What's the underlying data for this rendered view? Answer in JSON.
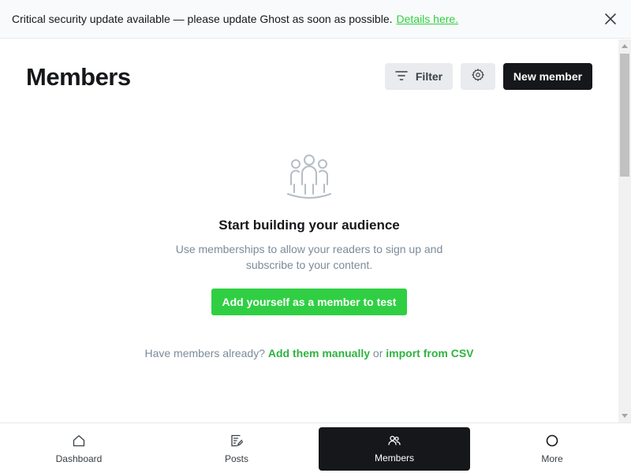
{
  "banner": {
    "message": "Critical security update available — please update Ghost as soon as possible.",
    "link_label": "Details here."
  },
  "header": {
    "title": "Members",
    "filter_label": "Filter",
    "new_member_label": "New member"
  },
  "empty_state": {
    "title": "Start building your audience",
    "description": "Use memberships to allow your readers to sign up and subscribe to your content.",
    "cta_label": "Add yourself as a member to test",
    "already_prefix": "Have members already?",
    "add_manually_label": "Add them manually",
    "or_label": "or",
    "import_csv_label": "import from CSV"
  },
  "nav": {
    "items": [
      {
        "label": "Dashboard",
        "icon": "home-icon"
      },
      {
        "label": "Posts",
        "icon": "posts-icon"
      },
      {
        "label": "Members",
        "icon": "members-icon",
        "active": true
      },
      {
        "label": "More",
        "icon": "circle-icon"
      }
    ]
  },
  "colors": {
    "accent": "#30cf43",
    "dark": "#15171a",
    "button_gray": "#e9ebee"
  }
}
